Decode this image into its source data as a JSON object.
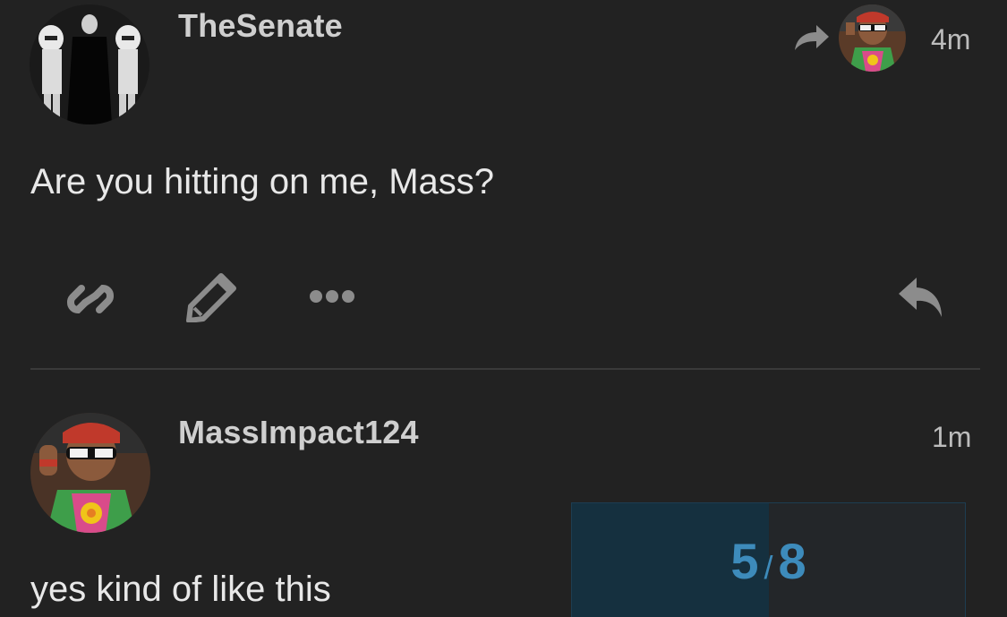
{
  "posts": [
    {
      "username": "TheSenate",
      "timestamp": "4m",
      "text": "Are you hitting on me, Mass?",
      "reply_to_indicator": "reply-arrow-icon",
      "actions": [
        "link-icon",
        "pencil-icon",
        "more-icon",
        "reply-icon"
      ]
    },
    {
      "username": "MassImpact124",
      "timestamp": "1m",
      "text": "yes kind of like this"
    }
  ],
  "timeline": {
    "current": "5",
    "separator": "/",
    "total": "8",
    "progress_fraction": 0.5
  },
  "colors": {
    "background": "#222222",
    "text": "#e8e8e8",
    "icon": "#8c8c8c",
    "accent": "#3d8bbb",
    "progress_fill": "#15303f"
  }
}
